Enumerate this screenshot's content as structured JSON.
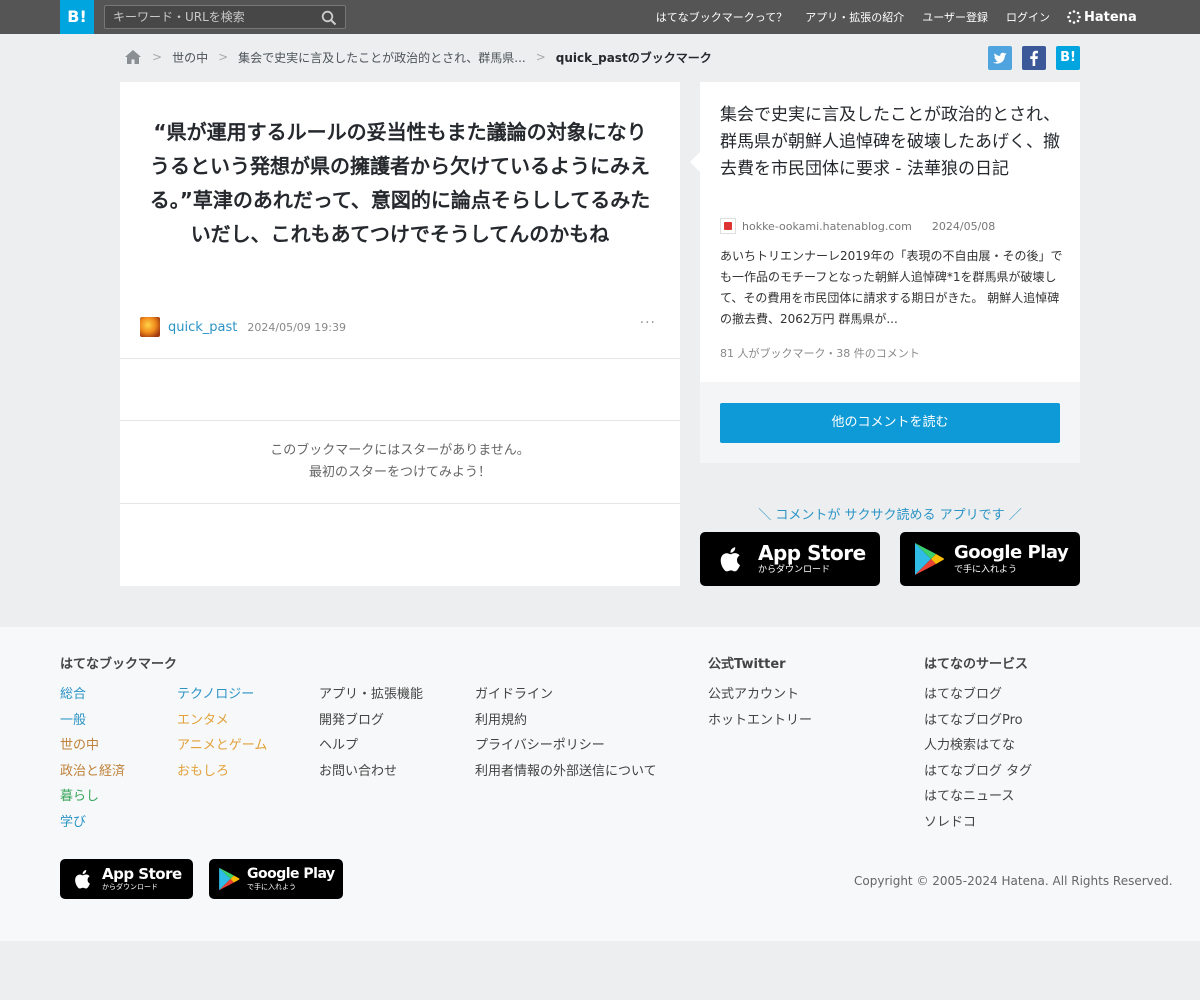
{
  "header": {
    "logo": "B!",
    "search_placeholder": "キーワード・URLを検索",
    "nav": [
      "はてなブックマークって？",
      "アプリ・拡張の紹介",
      "ユーザー登録",
      "ログイン"
    ],
    "brand": "Hatena"
  },
  "breadcrumb": {
    "items": [
      "世の中",
      "集会で史実に言及したことが政治的とされ、群馬県..."
    ],
    "current": "quick_pastのブックマーク"
  },
  "share": {
    "twitter": "t",
    "facebook": "f",
    "hatena": "B!",
    "colors": {
      "twitter": "#4fa3de",
      "facebook": "#3b5998",
      "hatena": "#00a4de"
    }
  },
  "bookmark": {
    "comment": "“県が運用するルールの妥当性もまた議論の対象になりうるという発想が県の擁護者から欠けているようにみえる。”草津のあれだって、意図的に論点そらししてるみたいだし、これもあてつけでそうしてんのかもね",
    "user": "quick_past",
    "timestamp": "2024/05/09 19:39",
    "more": "···",
    "no_star_line1": "このブックマークにはスターがありません。",
    "no_star_line2": "最初のスターをつけてみよう！"
  },
  "entry": {
    "title": "集会で史実に言及したことが政治的とされ、群馬県が朝鮮人追悼碑を破壊したあげく、撤去費を市民団体に要求 - 法華狼の日記",
    "domain": "hokke-ookami.hatenablog.com",
    "date": "2024/05/08",
    "summary": "あいちトリエンナーレ2019年の「表現の不自由展・その後」でも一作品のモチーフとなった朝鮮人追悼碑*1を群馬県が破壊して、その費用を市民団体に請求する期日がきた。 朝鮮人追悼碑の撤去費、2062万円 群馬県が...",
    "count_text": "81 人がブックマーク・38 件のコメント",
    "more_button": "他のコメントを読む"
  },
  "app_promo": {
    "text": "＼ コメントが サクサク読める アプリです ／",
    "appstore_big": "App Store",
    "appstore_small": "からダウンロード",
    "googleplay_big": "Google Play",
    "googleplay_small": "で手に入れよう"
  },
  "footer": {
    "col1_title": "はてなブックマーク",
    "categories_a": [
      {
        "label": "総合",
        "color": "#2b94c5"
      },
      {
        "label": "一般",
        "color": "#2b94c5"
      },
      {
        "label": "世の中",
        "color": "#c0823a"
      },
      {
        "label": "政治と経済",
        "color": "#c0823a"
      },
      {
        "label": "暮らし",
        "color": "#3aa55c"
      },
      {
        "label": "学び",
        "color": "#2b94c5"
      }
    ],
    "categories_b": [
      {
        "label": "テクノロジー",
        "color": "#2b94c5"
      },
      {
        "label": "エンタメ",
        "color": "#e2a13a"
      },
      {
        "label": "アニメとゲーム",
        "color": "#e2a13a"
      },
      {
        "label": "おもしろ",
        "color": "#e2a13a"
      }
    ],
    "links_c": [
      "アプリ・拡張機能",
      "開発ブログ",
      "ヘルプ",
      "お問い合わせ"
    ],
    "links_d": [
      "ガイドライン",
      "利用規約",
      "プライバシーポリシー",
      "利用者情報の外部送信について"
    ],
    "twitter_title": "公式Twitter",
    "twitter_links": [
      "公式アカウント",
      "ホットエントリー"
    ],
    "services_title": "はてなのサービス",
    "services_links": [
      "はてなブログ",
      "はてなブログPro",
      "人力検索はてな",
      "はてなブログ タグ",
      "はてなニュース",
      "ソレドコ"
    ],
    "copyright": "Copyright © 2005-2024 Hatena. All Rights Reserved."
  }
}
